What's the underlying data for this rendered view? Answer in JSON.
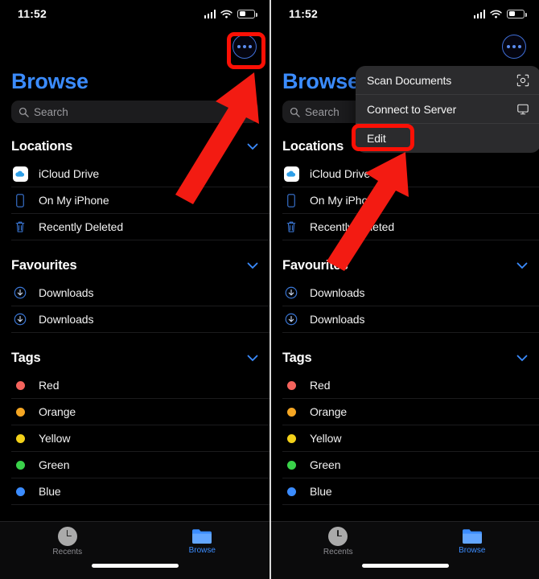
{
  "status": {
    "time": "11:52",
    "signal_icon": "cellular-signal-icon",
    "wifi_icon": "wifi-icon",
    "battery_icon": "battery-icon"
  },
  "header": {
    "title": "Browse",
    "more_button_icon": "ellipsis-circle-icon"
  },
  "search": {
    "placeholder": "Search",
    "icon": "search-icon"
  },
  "sections": [
    {
      "title": "Locations",
      "collapse_icon": "chevron-down-icon",
      "items": [
        {
          "label": "iCloud Drive",
          "icon": "icloud-drive-icon"
        },
        {
          "label": "On My iPhone",
          "icon": "iphone-icon"
        },
        {
          "label": "Recently Deleted",
          "icon": "trash-icon"
        }
      ]
    },
    {
      "title": "Favourites",
      "collapse_icon": "chevron-down-icon",
      "items": [
        {
          "label": "Downloads",
          "icon": "download-circle-icon"
        },
        {
          "label": "Downloads",
          "icon": "download-circle-icon"
        }
      ]
    },
    {
      "title": "Tags",
      "collapse_icon": "chevron-down-icon",
      "items": [
        {
          "label": "Red",
          "icon": "tag-dot-icon",
          "color": "#f4635c"
        },
        {
          "label": "Orange",
          "icon": "tag-dot-icon",
          "color": "#f5a623"
        },
        {
          "label": "Yellow",
          "icon": "tag-dot-icon",
          "color": "#f3d119"
        },
        {
          "label": "Green",
          "icon": "tag-dot-icon",
          "color": "#3ad24a"
        },
        {
          "label": "Blue",
          "icon": "tag-dot-icon",
          "color": "#3b8cff"
        }
      ]
    }
  ],
  "tabbar": {
    "tabs": [
      {
        "label": "Recents",
        "icon": "clock-icon",
        "active": false
      },
      {
        "label": "Browse",
        "icon": "folder-icon",
        "active": true
      }
    ]
  },
  "context_menu": {
    "items": [
      {
        "label": "Scan Documents",
        "icon": "document-scanner-icon"
      },
      {
        "label": "Connect to Server",
        "icon": "display-monitor-icon"
      },
      {
        "label": "Edit",
        "icon": ""
      }
    ]
  },
  "annotations": {
    "highlight_color": "#fb1005",
    "arrow_color": "#f31b12",
    "left_arrow_target": "ellipsis-circle-icon",
    "right_arrow_target": "Edit"
  }
}
